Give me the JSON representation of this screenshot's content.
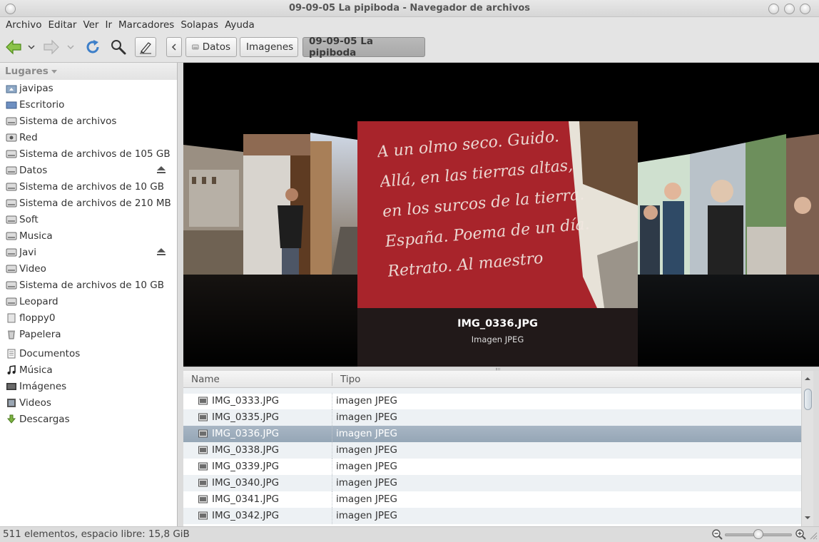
{
  "window": {
    "title": "09-09-05 La pipiboda - Navegador de archivos"
  },
  "menu": {
    "items": [
      "Archivo",
      "Editar",
      "Ver",
      "Ir",
      "Marcadores",
      "Solapas",
      "Ayuda"
    ]
  },
  "toolbar": {
    "icons": [
      "back-arrow-icon",
      "forward-arrow-icon",
      "reload-icon",
      "search-icon",
      "edit-location-icon"
    ],
    "path": [
      "Datos",
      "Imagenes",
      "09-09-05 La pipiboda"
    ],
    "active_path": "09-09-05 La pipiboda"
  },
  "sidebar": {
    "heading": "Lugares",
    "items": [
      {
        "label": "javipas",
        "icon": "home-folder-icon"
      },
      {
        "label": "Escritorio",
        "icon": "desktop-icon"
      },
      {
        "label": "Sistema de archivos",
        "icon": "drive-icon"
      },
      {
        "label": "Red",
        "icon": "network-icon"
      },
      {
        "label": "Sistema de archivos de 105 GB",
        "icon": "drive-icon"
      },
      {
        "label": "Datos",
        "icon": "drive-icon",
        "eject": true
      },
      {
        "label": "Sistema de archivos de 10 GB",
        "icon": "drive-icon"
      },
      {
        "label": "Sistema de archivos de 210 MB",
        "icon": "drive-icon"
      },
      {
        "label": "Soft",
        "icon": "drive-icon"
      },
      {
        "label": "Musica",
        "icon": "drive-icon"
      },
      {
        "label": "Javi",
        "icon": "drive-icon",
        "eject": true
      },
      {
        "label": "Video",
        "icon": "drive-icon"
      },
      {
        "label": "Sistema de archivos de 10 GB",
        "icon": "drive-icon"
      },
      {
        "label": "Leopard",
        "icon": "drive-icon"
      },
      {
        "label": "floppy0",
        "icon": "floppy-icon"
      },
      {
        "label": "Papelera",
        "icon": "trash-icon"
      },
      {
        "label": "Documentos",
        "icon": "documents-icon"
      },
      {
        "label": "Música",
        "icon": "music-icon"
      },
      {
        "label": "Imágenes",
        "icon": "pictures-icon"
      },
      {
        "label": "Videos",
        "icon": "videos-icon"
      },
      {
        "label": "Descargas",
        "icon": "downloads-icon"
      }
    ]
  },
  "coverflow": {
    "selected_title": "IMG_0336.JPG",
    "selected_subtitle": "Imagen JPEG",
    "wall_text": "A un olmo seco. Guido. Allá, en las tierras altas, en los surcos de la tierra. España. Poema de un día. Retrato. Al maestro"
  },
  "list": {
    "columns": [
      "Name",
      "Tipo"
    ],
    "rows": [
      {
        "name": "IMG_0333.JPG",
        "type": "imagen JPEG",
        "selected": false
      },
      {
        "name": "IMG_0335.JPG",
        "type": "imagen JPEG",
        "selected": false
      },
      {
        "name": "IMG_0336.JPG",
        "type": "imagen JPEG",
        "selected": true
      },
      {
        "name": "IMG_0338.JPG",
        "type": "imagen JPEG",
        "selected": false
      },
      {
        "name": "IMG_0339.JPG",
        "type": "imagen JPEG",
        "selected": false
      },
      {
        "name": "IMG_0340.JPG",
        "type": "imagen JPEG",
        "selected": false
      },
      {
        "name": "IMG_0341.JPG",
        "type": "imagen JPEG",
        "selected": false
      },
      {
        "name": "IMG_0342.JPG",
        "type": "imagen JPEG",
        "selected": false
      }
    ]
  },
  "status": {
    "text": "511 elementos, espacio libre: 15,8 GiB",
    "zoom_level": 0.5
  },
  "colors": {
    "selection": "#9aabbb",
    "wall_red": "#a8242b",
    "sidebar_bg": "#ffffff"
  }
}
